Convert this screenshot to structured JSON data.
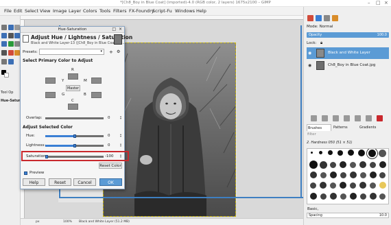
{
  "window": {
    "title": "*[Ch8_Boy in Blue Coat] (imported)-4.0 (RGB color, 2 layers) 1675x2100 – GIMP"
  },
  "menubar": [
    "File",
    "Edit",
    "Select",
    "View",
    "Image",
    "Layer",
    "Colors",
    "Tools",
    "Filters",
    "FX-Foundry",
    "Script-Fu",
    "Windows",
    "Help"
  ],
  "toolbox": {
    "tool_options_label": "Tool Op",
    "hue_saturation_label": "Hue-Saturation"
  },
  "dialog": {
    "window_title": "Hue-Saturation",
    "heading": "Adjust Hue / Lightness / Saturation",
    "subtitle": "Black and White Layer-13 ([Ch8_Boy in Blue Coat] (in...",
    "presets_label": "Presets:",
    "primary_color_label": "Select Primary Color to Adjust",
    "color_letters": {
      "r": "R",
      "y": "Y",
      "m": "M",
      "g": "G",
      "b": "B",
      "c": "C"
    },
    "master_label": "Master",
    "overlap": {
      "label": "Overlap:",
      "value": "0"
    },
    "adjust_selected_label": "Adjust Selected Color",
    "hue": {
      "label": "Hue:",
      "value": "0"
    },
    "lightness": {
      "label": "Lightness:",
      "value": "0"
    },
    "saturation": {
      "label": "Saturation:",
      "value": "-100"
    },
    "reset_color_label": "Reset Color",
    "preview_label": "Preview",
    "preview_checked": true,
    "buttons": {
      "help": "Help",
      "reset": "Reset",
      "cancel": "Cancel",
      "ok": "OK"
    }
  },
  "right_panel": {
    "mode_label": "Mode: Normal",
    "opacity_label": "Opacity",
    "opacity_value": "100.0",
    "lock_label": "Lock:",
    "layers": [
      {
        "name": "Black and White Layer",
        "selected": true
      },
      {
        "name": "Ch8_Boy in Blue Coat.jpg",
        "selected": false
      }
    ],
    "tabs": [
      "Brushes",
      "Patterns",
      "Gradients"
    ],
    "filter_label": "filter",
    "brush_name": "2. Hardness 050 (51 × 51)",
    "preset_label": "Basic,",
    "spacing_label": "Spacing",
    "spacing_value": "10.0"
  },
  "statusbar": {
    "units": "px",
    "zoom": "100%",
    "layer_info": "Black and White Layer (51.2 MB)"
  },
  "colors": {
    "accent": "#5b9bd5",
    "highlight": "#c9282d",
    "guide": "#3e7fc1"
  },
  "icons": [
    "close-icon",
    "maximize-icon",
    "minimize-icon",
    "eye-icon",
    "lock-icon",
    "gear-icon",
    "pin-icon",
    "plus-icon",
    "spin-arrows-icon"
  ]
}
